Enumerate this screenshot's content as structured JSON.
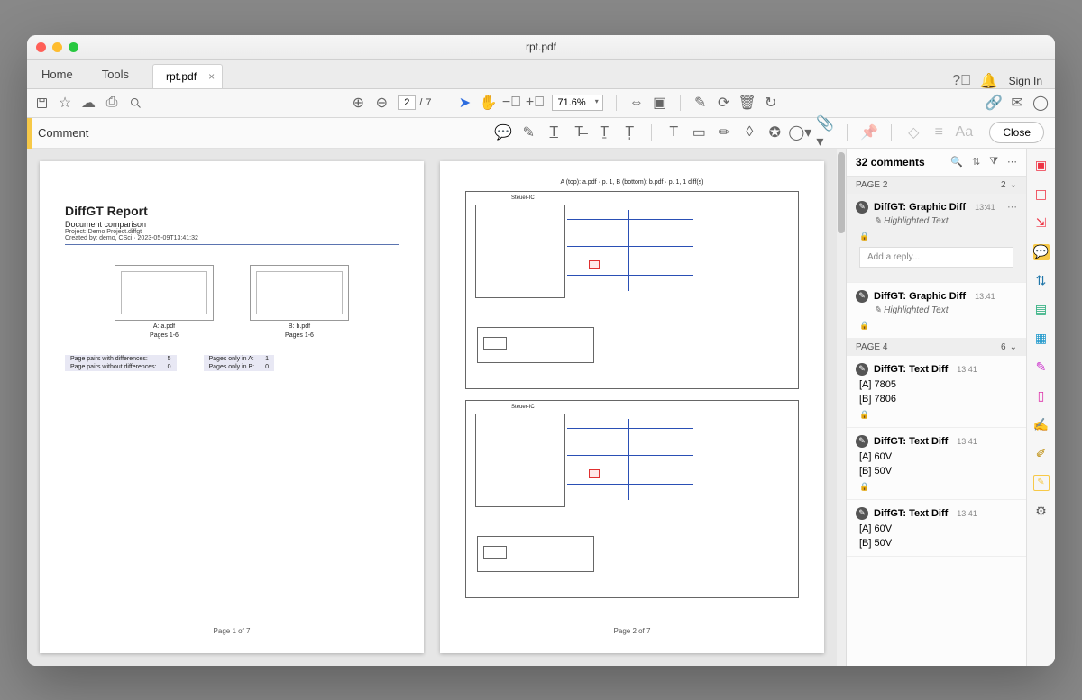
{
  "window": {
    "title": "rpt.pdf"
  },
  "nav": {
    "home": "Home",
    "tools": "Tools",
    "signin": "Sign In"
  },
  "tab": {
    "name": "rpt.pdf"
  },
  "page_ctl": {
    "current": "2",
    "sep": "/",
    "total": "7"
  },
  "zoom": "71.6%",
  "commentbar": {
    "label": "Comment",
    "close": "Close"
  },
  "doc": {
    "p1": {
      "title": "DiffGT Report",
      "subtitle": "Document comparison",
      "proj": "Project: Demo Project.diffgt",
      "created": "Created by: demo, CSci · 2023-05-09T13:41:32",
      "thumbA": {
        "label": "A: a.pdf",
        "pages": "Pages 1-6"
      },
      "thumbB": {
        "label": "B: b.pdf",
        "pages": "Pages 1-6"
      },
      "stats": {
        "r1k": "Page pairs with differences:",
        "r1v": "5",
        "r2k": "Page pairs without differences:",
        "r2v": "0",
        "r3k": "Pages only in A:",
        "r3v": "1",
        "r4k": "Pages only in B:",
        "r4v": "0"
      },
      "footer": "Page 1 of 7"
    },
    "p2": {
      "header": "A (top): a.pdf · p. 1, B (bottom): b.pdf · p. 1, 1 diff(s)",
      "chip": "Steuer-IC",
      "footer": "Page 2 of 7"
    }
  },
  "comments": {
    "header": "32 comments",
    "page2": {
      "label": "PAGE 2",
      "count": "2"
    },
    "page4": {
      "label": "PAGE 4",
      "count": "6"
    },
    "c1": {
      "title": "DiffGT: Graphic Diff",
      "time": "13:41",
      "sub": "Highlighted Text"
    },
    "reply_ph": "Add a reply...",
    "c2": {
      "title": "DiffGT: Graphic Diff",
      "time": "13:41",
      "sub": "Highlighted Text"
    },
    "c3": {
      "title": "DiffGT: Text Diff",
      "time": "13:41",
      "a": "[A] 7805",
      "b": "[B] 7806"
    },
    "c4": {
      "title": "DiffGT: Text Diff",
      "time": "13:41",
      "a": "[A] 60V",
      "b": "[B] 50V"
    },
    "c5": {
      "title": "DiffGT: Text Diff",
      "time": "13:41",
      "a": "[A] 60V",
      "b": "[B] 50V"
    }
  }
}
